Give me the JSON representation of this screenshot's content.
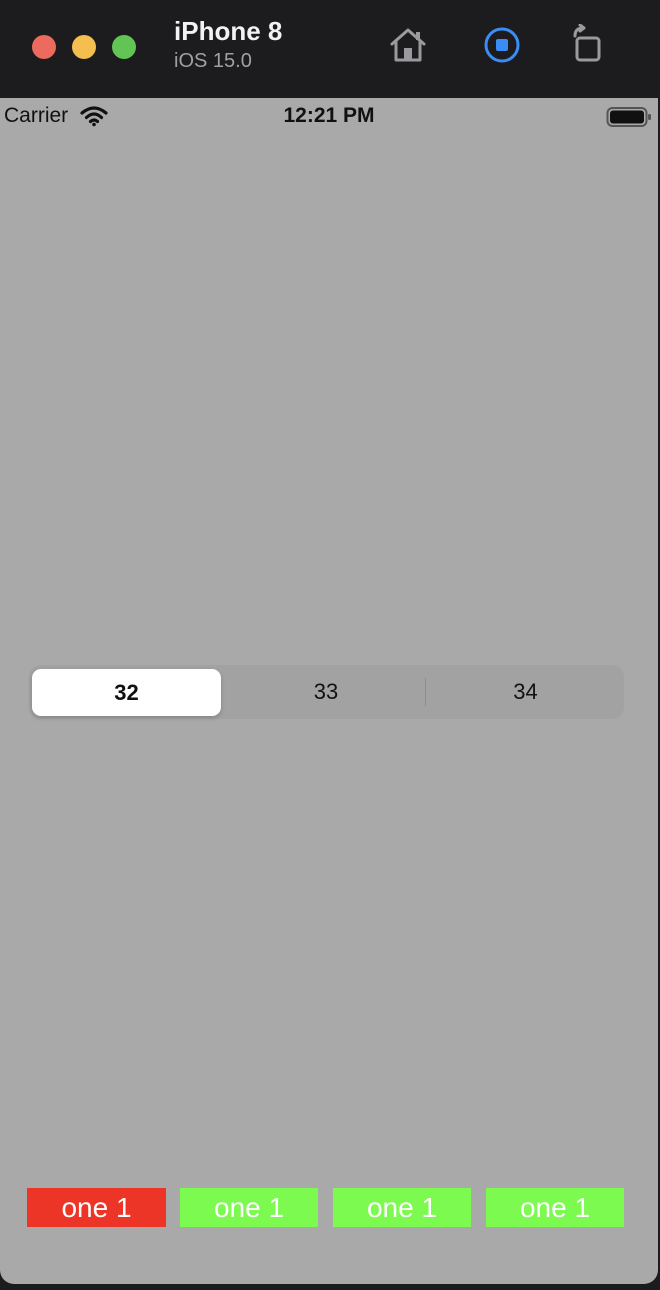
{
  "titlebar": {
    "device_name": "iPhone 8",
    "os_version": "iOS 15.0",
    "buttons": [
      "home-icon",
      "screenshot-icon",
      "rotate-icon"
    ],
    "accent_color": "#3a8df5"
  },
  "statusbar": {
    "carrier": "Carrier",
    "time": "12:21 PM"
  },
  "segmented_control": {
    "segments": [
      "32",
      "33",
      "34"
    ],
    "selected_index": 0
  },
  "labels": [
    {
      "text": "one 1",
      "color": "#ec3427"
    },
    {
      "text": "one 1",
      "color": "#7cfa4f"
    },
    {
      "text": "one 1",
      "color": "#7cfa4f"
    },
    {
      "text": "one 1",
      "color": "#7cfa4f"
    }
  ]
}
